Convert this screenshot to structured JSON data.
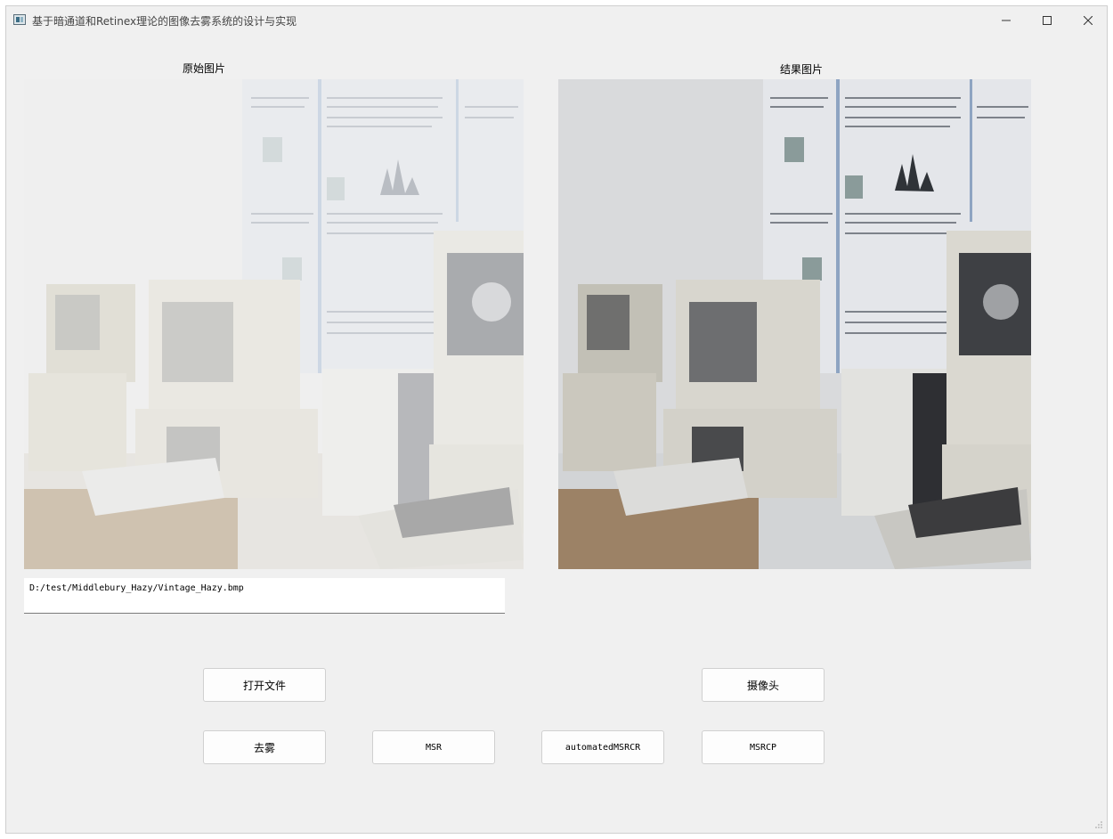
{
  "window": {
    "title": "基于暗通道和Retinex理论的图像去雾系统的设计与实现"
  },
  "panels": {
    "original_label": "原始图片",
    "result_label": "结果图片"
  },
  "file_path": "D:/test/Middlebury_Hazy/Vintage_Hazy.bmp",
  "buttons": {
    "open_file": "打开文件",
    "camera": "摄像头",
    "dehaze": "去雾",
    "msr": "MSR",
    "automated_msrcr": "automatedMSRCR",
    "msrcp": "MSRCP"
  },
  "colors": {
    "window_bg": "#f0f0f0",
    "button_bg": "#fdfdfd",
    "button_border": "#d0d0d0"
  }
}
